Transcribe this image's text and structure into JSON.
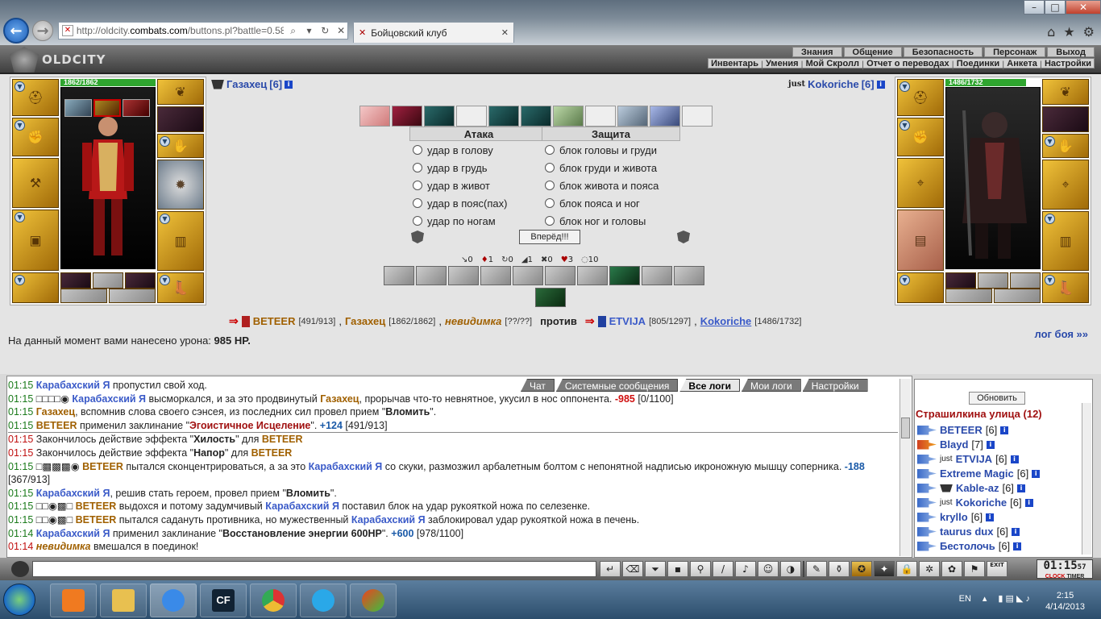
{
  "browser": {
    "url_prefix": "http://oldcity.",
    "url_domain": "combats.com",
    "url_path": "/buttons.pl?battle=0.58",
    "tab_title": "Бойцовский клуб"
  },
  "game": {
    "logo": "OLDCITY",
    "top_menu": [
      "Знания",
      "Общение",
      "Безопасность",
      "Персонаж",
      "Выход"
    ],
    "sub_menu": [
      "Инвентарь",
      "Умения",
      "Мой Скролл",
      "Отчет о переводах",
      "Поединки",
      "Анкета",
      "Настройки"
    ]
  },
  "player_left": {
    "hp": "1862/1862",
    "name": "Газахец",
    "level": "[6]"
  },
  "player_right": {
    "hp": "1486/1732",
    "name_prefix": "just",
    "name": "Kokoriche",
    "level": "[6]"
  },
  "attack": {
    "header": "Атака",
    "options": [
      "удар в голову",
      "удар в грудь",
      "удар в живот",
      "удар в пояс(пах)",
      "удар по ногам"
    ]
  },
  "defense": {
    "header": "Защита",
    "options": [
      "блок головы и груди",
      "блок груди и живота",
      "блок живота и пояса",
      "блок пояса и ног",
      "блок ног и головы"
    ]
  },
  "go_button": "Вперёд!!!",
  "stats": [
    "0",
    "1",
    "0",
    "1",
    "0",
    "3",
    "10"
  ],
  "battle": {
    "team1_a": "BETEER",
    "team1_a_hp": "[491/913]",
    "sep1": ",",
    "team1_b": "Газахец",
    "team1_b_hp": "[1862/1862]",
    "sep2": ",",
    "team1_c": "невидимка",
    "team1_c_hp": "[??/??]",
    "vs": "против",
    "team2_a": "ETVIJA",
    "team2_a_hp": "[805/1297]",
    "sep3": ",",
    "team2_b": "Kokoriche",
    "team2_b_hp": "[1486/1732]"
  },
  "damage": {
    "label": "На данный момент вами нанесено урона:",
    "value": "985 HP."
  },
  "log_link": "лог боя »»",
  "log_tabs": [
    "Чат",
    "Системные сообщения",
    "Все логи",
    "Мои логи",
    "Настройки"
  ],
  "log": {
    "l1": {
      "t": "01:15",
      "a": "Карабахский Я",
      "b": " пропустил свой ход."
    },
    "l2": {
      "t": "01:15",
      "m": "□□□□◉ ",
      "a": "Карабахский Я",
      "b": " высморкался, и за это продвинутый ",
      "c": "Газахец",
      "d": ", прорычав что-то невнятное, укусил в нос оппонента. ",
      "e": "-985",
      "f": " [0/1100]"
    },
    "l3": {
      "t": "01:15",
      "a": "Газахец",
      "b": ", вспомнив слова своего сэнсея, из последних сил провел прием \"",
      "c": "Вломить",
      "d": "\"."
    },
    "l4": {
      "t": "01:15",
      "a": "BETEER",
      "b": " применил заклинание \"",
      "c": "Эгоистичное Исцеление",
      "d": "\". ",
      "e": "+124",
      "f": " [491/913]"
    },
    "l5": {
      "t": "01:15",
      "a": "Закончилось действие эффекта \"",
      "b": "Хилость",
      "c": "\" для ",
      "d": "BETEER"
    },
    "l6": {
      "t": "01:15",
      "a": "Закончилось действие эффекта \"",
      "b": "Напор",
      "c": "\" для ",
      "d": "BETEER"
    },
    "l7": {
      "t": "01:15",
      "m": "□▩▩▩◉ ",
      "a": "BETEER",
      "b": " пытался сконцентрироваться, а за это ",
      "c": "Карабахский Я",
      "d": " со скуки, размозжил арбалетным болтом с непонятной надписью икроножную мышцу соперника. ",
      "e": "-188",
      "f": " [367/913]"
    },
    "l8": {
      "t": "01:15",
      "a": "Карабахский Я",
      "b": ", решив стать героем, провел прием \"",
      "c": "Вломить",
      "d": "\"."
    },
    "l9": {
      "t": "01:15",
      "m": "□□◉▩□ ",
      "a": "BETEER",
      "b": " выдохся и потому задумчивый ",
      "c": "Карабахский Я",
      "d": " поставил блок на удар рукояткой ножа по селезенке."
    },
    "l10": {
      "t": "01:15",
      "m": "□□◉▩□ ",
      "a": "BETEER",
      "b": " пытался садануть противника, но мужественный ",
      "c": "Карабахский Я",
      "d": " заблокировал удар рукояткой ножа в печень."
    },
    "l11": {
      "t": "01:14",
      "a": "Карабахский Я",
      "b": " применил заклинание \"",
      "c": "Восстановление энергии 600HP",
      "d": "\". ",
      "e": "+600",
      "f": " [978/1100]"
    },
    "l12": {
      "t": "01:14",
      "a": "невидимка",
      "b": " вмешался в поединок!"
    }
  },
  "right_list": {
    "refresh": "Обновить",
    "location": "Страшилкина улица (12)",
    "players": [
      {
        "name": "BETEER",
        "level": "[6]"
      },
      {
        "name": "Blayd",
        "level": "[7]"
      },
      {
        "prefix": "just",
        "name": "ETVIJA",
        "level": "[6]"
      },
      {
        "name": "Extreme Magic",
        "level": "[6]"
      },
      {
        "name": "Kable-az",
        "level": "[6]"
      },
      {
        "prefix": "just",
        "name": "Kokoriche",
        "level": "[6]"
      },
      {
        "name": "kryllo",
        "level": "[6]"
      },
      {
        "name": "taurus dux",
        "level": "[6]"
      },
      {
        "name": "Бестолочь",
        "level": "[6]"
      }
    ]
  },
  "timer": {
    "time": "01:15",
    "sec": "57",
    "clock": "CLOCK",
    "timer_label": "TIMER",
    "exit": "EXIT"
  },
  "tray": {
    "lang": "EN",
    "time": "2:15",
    "date": "4/14/2013"
  },
  "icons": {
    "back": "back-arrow-icon",
    "forward": "forward-arrow-icon",
    "home": "home-icon",
    "star": "star-icon",
    "gear": "gear-icon"
  }
}
